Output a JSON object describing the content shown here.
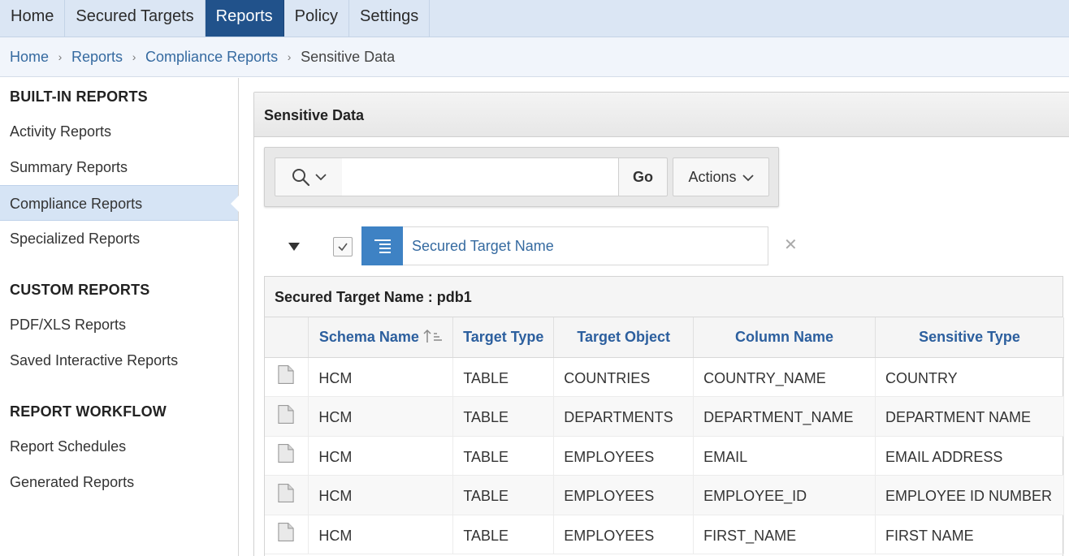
{
  "nav": {
    "tabs": [
      {
        "label": "Home"
      },
      {
        "label": "Secured Targets"
      },
      {
        "label": "Reports",
        "active": true
      },
      {
        "label": "Policy"
      },
      {
        "label": "Settings"
      }
    ]
  },
  "breadcrumb": {
    "home": "Home",
    "reports": "Reports",
    "compliance": "Compliance Reports",
    "current": "Sensitive Data"
  },
  "sidebar": {
    "builtin_heading": "BUILT-IN REPORTS",
    "activity": "Activity Reports",
    "summary": "Summary Reports",
    "compliance": "Compliance Reports",
    "specialized": "Specialized Reports",
    "custom_heading": "CUSTOM REPORTS",
    "pdfxls": "PDF/XLS Reports",
    "saved": "Saved Interactive Reports",
    "workflow_heading": "REPORT WORKFLOW",
    "schedules": "Report Schedules",
    "generated": "Generated Reports"
  },
  "region": {
    "title": "Sensitive Data"
  },
  "toolbar": {
    "search_value": "",
    "search_placeholder": "",
    "go_label": "Go",
    "actions_label": "Actions"
  },
  "control_break": {
    "label": "Secured Target Name",
    "checked": true
  },
  "report": {
    "group_label": "Secured Target Name : pdb1",
    "columns": {
      "schema": "Schema Name",
      "type": "Target Type",
      "object": "Target Object",
      "column": "Column Name",
      "sensitive": "Sensitive Type"
    },
    "rows": [
      {
        "schema": "HCM",
        "type": "TABLE",
        "object": "COUNTRIES",
        "column": "COUNTRY_NAME",
        "sensitive": "COUNTRY"
      },
      {
        "schema": "HCM",
        "type": "TABLE",
        "object": "DEPARTMENTS",
        "column": "DEPARTMENT_NAME",
        "sensitive": "DEPARTMENT NAME"
      },
      {
        "schema": "HCM",
        "type": "TABLE",
        "object": "EMPLOYEES",
        "column": "EMAIL",
        "sensitive": "EMAIL ADDRESS"
      },
      {
        "schema": "HCM",
        "type": "TABLE",
        "object": "EMPLOYEES",
        "column": "EMPLOYEE_ID",
        "sensitive": "EMPLOYEE ID NUMBER"
      },
      {
        "schema": "HCM",
        "type": "TABLE",
        "object": "EMPLOYEES",
        "column": "FIRST_NAME",
        "sensitive": "FIRST NAME"
      }
    ]
  },
  "colors": {
    "nav_active": "#21528b",
    "link": "#356aa0",
    "filter_icon_bg": "#3e82c4"
  }
}
